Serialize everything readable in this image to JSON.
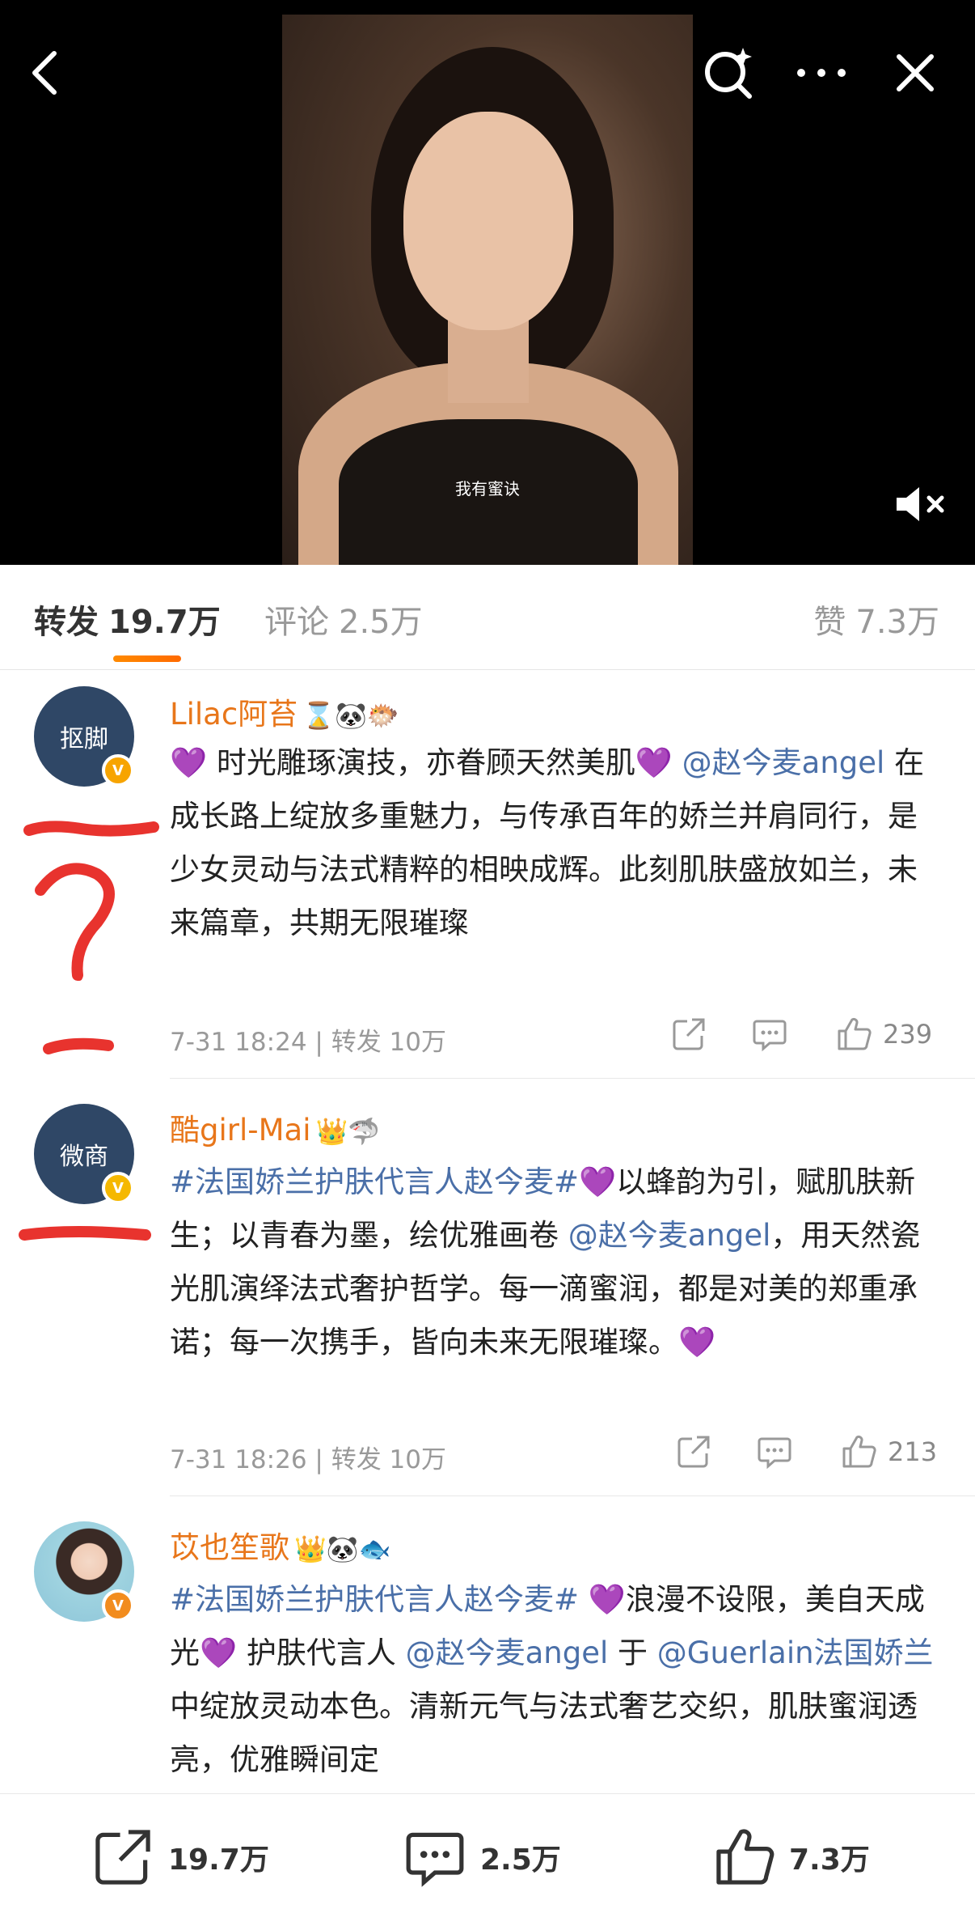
{
  "video": {
    "caption": "我有蜜诀"
  },
  "tabs": {
    "repost": {
      "label": "转发",
      "count": "19.7万"
    },
    "comment": {
      "label": "评论",
      "count": "2.5万"
    },
    "like": {
      "label": "赞",
      "count": "7.3万"
    }
  },
  "reposts": [
    {
      "avatar_text": "抠脚",
      "username": "Lilac阿苔",
      "username_emojis": "⌛🐼🐡",
      "text": "💜 时光雕琢演技，亦眷顾天然美肌💜 ",
      "mention": "@赵今麦angel",
      "text2": " 在成长路上绽放多重魅力，与传承百年的娇兰并肩同行，是少女灵动与法式精粹的相映成辉。此刻肌肤盛放如兰，未来篇章，共期无限璀璨",
      "time": "7-31 18:24",
      "repost_meta": "| 转发 10万",
      "likes": "239"
    },
    {
      "avatar_text": "微商",
      "username": "酷girl-Mai",
      "username_emojis": "👑🦈",
      "tag": "#法国娇兰护肤代言人赵今麦#",
      "text": "💜以蜂韵为引，赋肌肤新生；以青春为墨，绘优雅画卷 ",
      "mention": "@赵今麦angel",
      "text2": "，用天然瓷光肌演绎法式奢护哲学。每一滴蜜润，都是对美的郑重承诺；每一次携手，皆向未来无限璀璨。💜",
      "time": "7-31 18:26",
      "repost_meta": "| 转发 10万",
      "likes": "213"
    },
    {
      "username": "苡也笙歌",
      "username_emojis": "👑🐼🐟",
      "tag": "#法国娇兰护肤代言人赵今麦#",
      "text": " 💜浪漫不设限，美自天成光💜 护肤代言人 ",
      "mention": "@赵今麦angel",
      "text2": " 于 ",
      "mention2": "@Guerlain法国娇兰",
      "text3": " 中绽放灵动本色。清新元气与法式奢艺交织，肌肤蜜润透亮，优雅瞬间定"
    }
  ],
  "bottom_bar": {
    "share_count": "19.7万",
    "comment_count": "2.5万",
    "like_count": "7.3万"
  },
  "colors": {
    "accent": "#e8761a",
    "link": "#4a6fa8",
    "annotation": "#e8332e"
  }
}
